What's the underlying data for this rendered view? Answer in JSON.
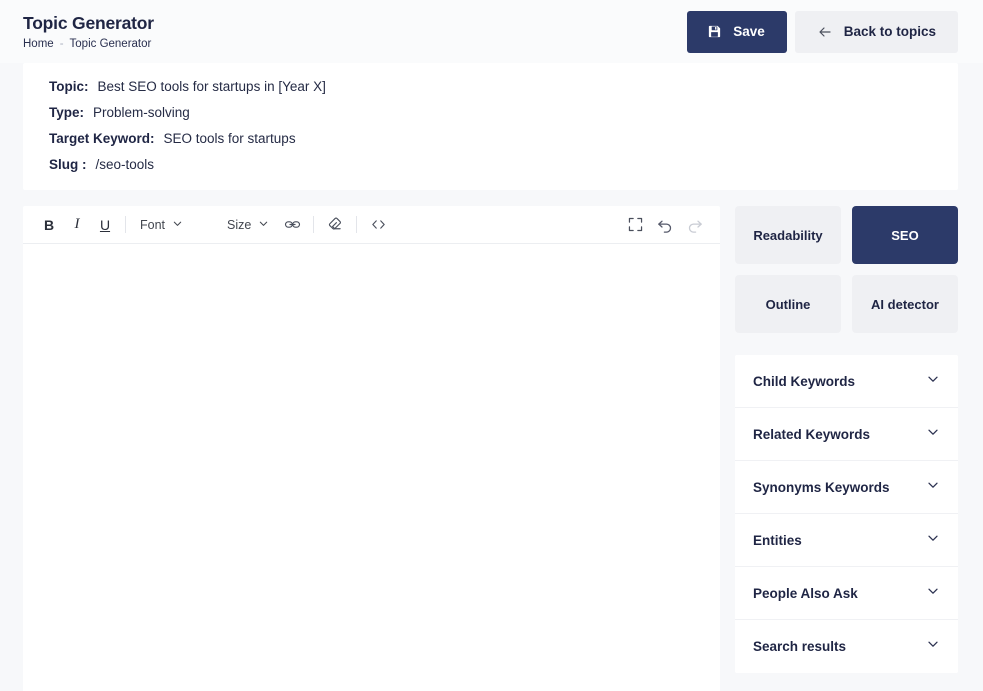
{
  "header": {
    "title": "Topic Generator",
    "breadcrumb": {
      "home": "Home",
      "separator": "-",
      "current": "Topic Generator"
    },
    "save_label": "Save",
    "save_icon": "save-floppy-icon",
    "back_label": "Back to topics",
    "back_icon": "arrow-left-icon"
  },
  "meta": {
    "rows": [
      {
        "label": "Topic:",
        "value": "Best SEO tools for startups in [Year X]"
      },
      {
        "label": "Type:",
        "value": "Problem-solving"
      },
      {
        "label": "Target Keyword:",
        "value": "SEO tools for startups"
      },
      {
        "label": "Slug :",
        "value": "/seo-tools"
      }
    ]
  },
  "editor": {
    "toolbar": {
      "bold": "B",
      "italic": "I",
      "underline": "U",
      "font_label": "Font",
      "size_label": "Size",
      "link_icon": "link-icon",
      "eraser_icon": "eraser-icon",
      "code_icon": "code-brackets-icon",
      "fullscreen_icon": "fullscreen-icon",
      "undo_icon": "undo-icon",
      "redo_icon": "redo-icon"
    },
    "content": ""
  },
  "side": {
    "tabs": [
      {
        "label": "Readability",
        "active": false
      },
      {
        "label": "SEO",
        "active": true
      },
      {
        "label": "Outline",
        "active": false
      },
      {
        "label": "AI detector",
        "active": false
      }
    ],
    "accordion": [
      {
        "label": "Child Keywords",
        "icon": "chevron-down-icon"
      },
      {
        "label": "Related Keywords",
        "icon": "chevron-down-icon"
      },
      {
        "label": "Synonyms Keywords",
        "icon": "chevron-down-icon"
      },
      {
        "label": "Entities",
        "icon": "chevron-down-icon"
      },
      {
        "label": "People Also Ask",
        "icon": "chevron-down-icon"
      },
      {
        "label": "Search results",
        "icon": "chevron-down-icon"
      }
    ]
  },
  "colors": {
    "accent": "#2c3a69",
    "page_bg": "#f7f8fa",
    "card_bg": "#ffffff",
    "muted_btn": "#eff0f3",
    "text": "#1f2544"
  }
}
